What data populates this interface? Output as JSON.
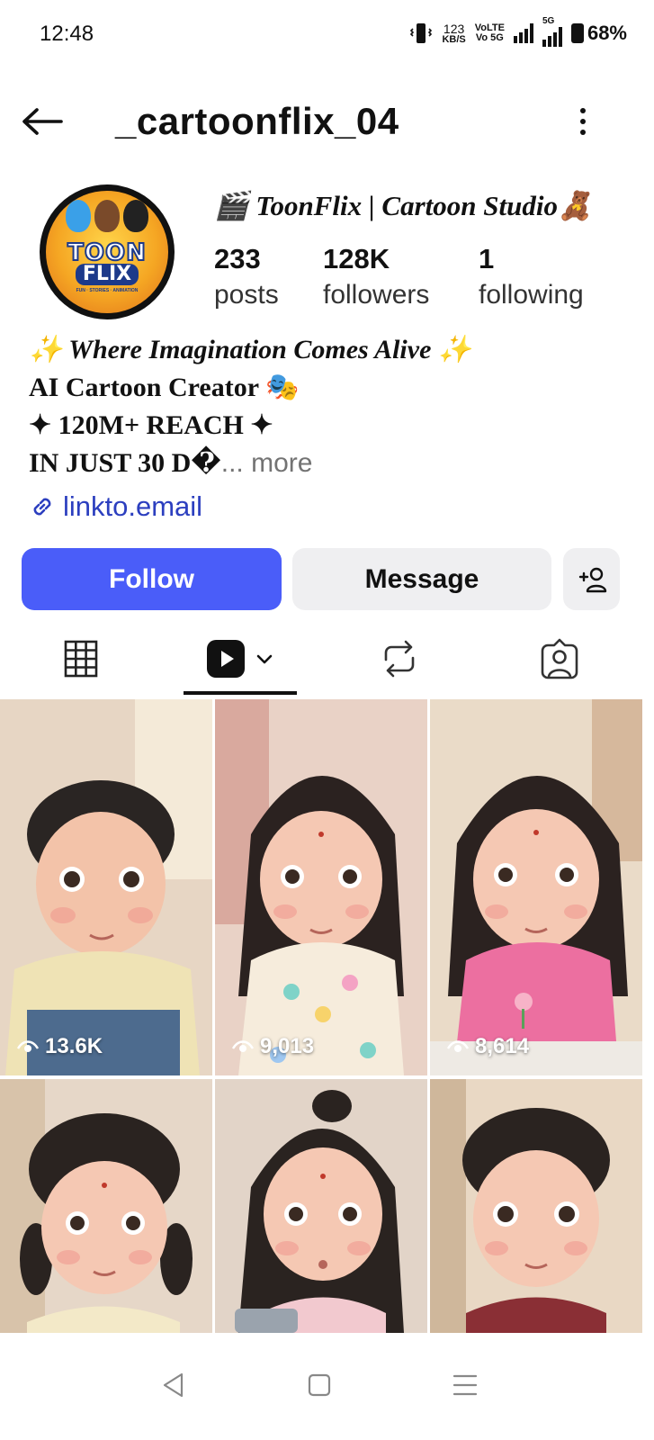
{
  "status_bar": {
    "time": "12:48",
    "net_speed_value": "123",
    "net_speed_unit": "KB/S",
    "volte_top": "VoLTE",
    "volte_bottom": "Vo 5G",
    "network_label": "5G",
    "battery": "68%"
  },
  "header": {
    "username": "_cartoonflix_04"
  },
  "profile": {
    "avatar_text_top": "TOON",
    "avatar_text_bottom": "FLIX",
    "avatar_subtext": "FUN · STORIES · ANIMATION",
    "display_name": "🎬 ToonFlix | Cartoon Studio🧸",
    "stats": [
      {
        "value": "233",
        "label": "posts"
      },
      {
        "value": "128K",
        "label": "followers"
      },
      {
        "value": "1",
        "label": "following"
      }
    ],
    "bio": {
      "line1": "✨ Where Imagination Comes Alive ✨",
      "line2": "AI Cartoon Creator 🎭",
      "line3": "✦ 120M+ REACH ✦",
      "line4": "IN JUST 30 D�",
      "more": "... more"
    },
    "link": "linkto.email"
  },
  "actions": {
    "follow": "Follow",
    "message": "Message"
  },
  "tabs": {
    "active": "reels"
  },
  "reels": [
    {
      "views": "13.6K"
    },
    {
      "views": "9,013"
    },
    {
      "views": "8,614"
    },
    {
      "views": ""
    },
    {
      "views": ""
    },
    {
      "views": ""
    }
  ],
  "colors": {
    "follow_button": "#4a5df9",
    "secondary_button": "#efeff1",
    "link": "#2c3fbf"
  }
}
